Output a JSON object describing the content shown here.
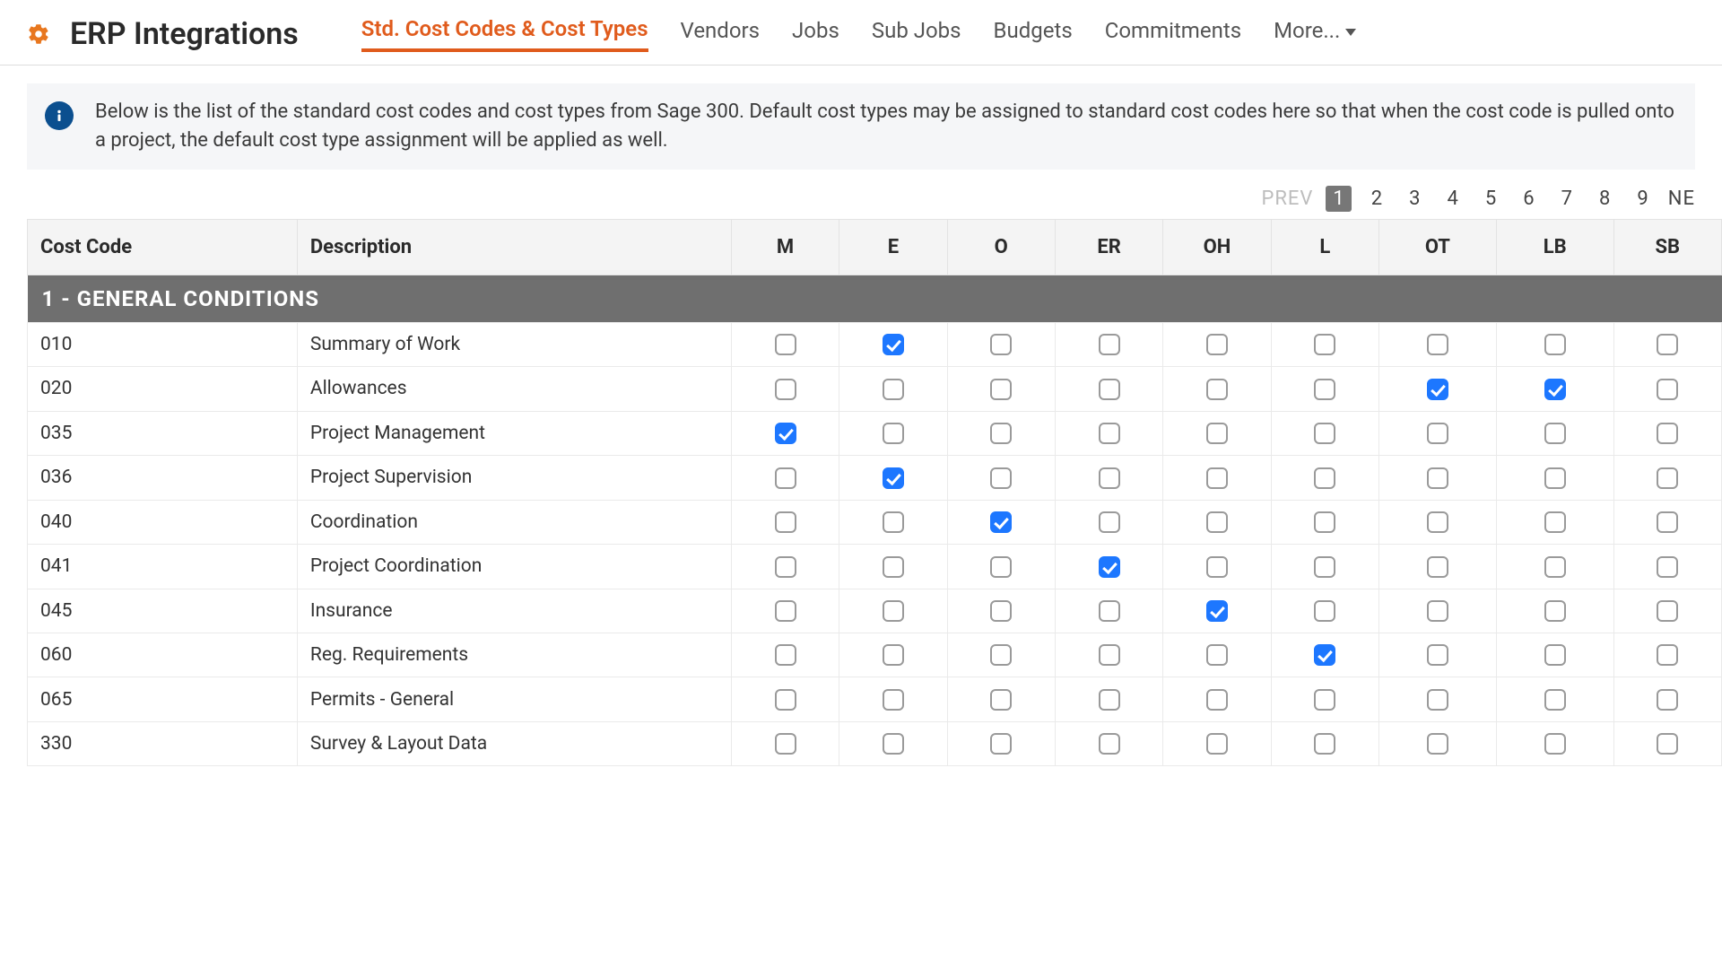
{
  "header": {
    "title": "ERP Integrations",
    "tabs": [
      {
        "label": "Std. Cost Codes & Cost Types",
        "active": true
      },
      {
        "label": "Vendors",
        "active": false
      },
      {
        "label": "Jobs",
        "active": false
      },
      {
        "label": "Sub Jobs",
        "active": false
      },
      {
        "label": "Budgets",
        "active": false
      },
      {
        "label": "Commitments",
        "active": false
      },
      {
        "label": "More...",
        "active": false,
        "dropdown": true
      }
    ]
  },
  "info_text": "Below is the list of the standard cost codes and cost types from Sage 300. Default cost types may be assigned to standard cost codes here so that when the cost code is pulled onto a project, the default cost type assignment will be applied as well.",
  "pager": {
    "prev": "PREV",
    "pages": [
      "1",
      "2",
      "3",
      "4",
      "5",
      "6",
      "7",
      "8",
      "9"
    ],
    "active": "1",
    "next": "NE"
  },
  "columns": {
    "code": "Cost Code",
    "desc": "Description",
    "types": [
      "M",
      "E",
      "O",
      "ER",
      "OH",
      "L",
      "OT",
      "LB",
      "SB"
    ]
  },
  "group_header": "1 - GENERAL CONDITIONS",
  "rows": [
    {
      "code": "010",
      "desc": "Summary of Work",
      "checks": {
        "M": false,
        "E": true,
        "O": false,
        "ER": false,
        "OH": false,
        "L": false,
        "OT": false,
        "LB": false,
        "SB": false
      }
    },
    {
      "code": "020",
      "desc": "Allowances",
      "checks": {
        "M": false,
        "E": false,
        "O": false,
        "ER": false,
        "OH": false,
        "L": false,
        "OT": true,
        "LB": true,
        "SB": false
      }
    },
    {
      "code": "035",
      "desc": "Project Management",
      "checks": {
        "M": true,
        "E": false,
        "O": false,
        "ER": false,
        "OH": false,
        "L": false,
        "OT": false,
        "LB": false,
        "SB": false
      }
    },
    {
      "code": "036",
      "desc": "Project Supervision",
      "checks": {
        "M": false,
        "E": true,
        "O": false,
        "ER": false,
        "OH": false,
        "L": false,
        "OT": false,
        "LB": false,
        "SB": false
      }
    },
    {
      "code": "040",
      "desc": "Coordination",
      "checks": {
        "M": false,
        "E": false,
        "O": true,
        "ER": false,
        "OH": false,
        "L": false,
        "OT": false,
        "LB": false,
        "SB": false
      }
    },
    {
      "code": "041",
      "desc": "Project Coordination",
      "checks": {
        "M": false,
        "E": false,
        "O": false,
        "ER": true,
        "OH": false,
        "L": false,
        "OT": false,
        "LB": false,
        "SB": false
      }
    },
    {
      "code": "045",
      "desc": "Insurance",
      "checks": {
        "M": false,
        "E": false,
        "O": false,
        "ER": false,
        "OH": true,
        "L": false,
        "OT": false,
        "LB": false,
        "SB": false
      }
    },
    {
      "code": "060",
      "desc": "Reg. Requirements",
      "checks": {
        "M": false,
        "E": false,
        "O": false,
        "ER": false,
        "OH": false,
        "L": true,
        "OT": false,
        "LB": false,
        "SB": false
      }
    },
    {
      "code": "065",
      "desc": "Permits - General",
      "checks": {
        "M": false,
        "E": false,
        "O": false,
        "ER": false,
        "OH": false,
        "L": false,
        "OT": false,
        "LB": false,
        "SB": false
      }
    },
    {
      "code": "330",
      "desc": "Survey & Layout Data",
      "checks": {
        "M": false,
        "E": false,
        "O": false,
        "ER": false,
        "OH": false,
        "L": false,
        "OT": false,
        "LB": false,
        "SB": false
      }
    }
  ]
}
